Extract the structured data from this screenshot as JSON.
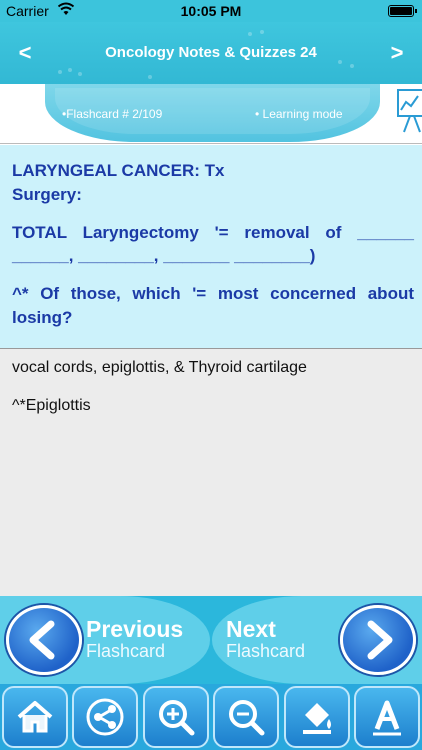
{
  "status_bar": {
    "carrier": "Carrier",
    "time": "10:05 PM"
  },
  "nav": {
    "title": "Oncology Notes & Quizzes 24",
    "back": "<",
    "forward": ">"
  },
  "info": {
    "flashcard": "•Flashcard #  2/109",
    "mode": "• Learning mode"
  },
  "question": {
    "line1": "LARYNGEAL CANCER: Tx",
    "line2": "Surgery:",
    "line3": "TOTAL Laryngectomy '= removal of ______ ______, ________, _______ ________)",
    "line4": "^* Of those, which '= most concerned about losing?"
  },
  "answer": {
    "line1": "vocal cords, epiglottis, & Thyroid cartilage",
    "line2": "^*Epiglottis"
  },
  "prev_next": {
    "prev_title": "Previous",
    "prev_sub": "Flashcard",
    "next_title": "Next",
    "next_sub": "Flashcard"
  },
  "toolbar": [
    "home-icon",
    "share-icon",
    "zoom-in-icon",
    "zoom-out-icon",
    "paint-bucket-icon",
    "font-icon"
  ],
  "colors": {
    "accent": "#3cc4dc",
    "question_text": "#1b3aa6",
    "question_bg": "#ccf2fb",
    "answer_bg": "#ececec"
  }
}
